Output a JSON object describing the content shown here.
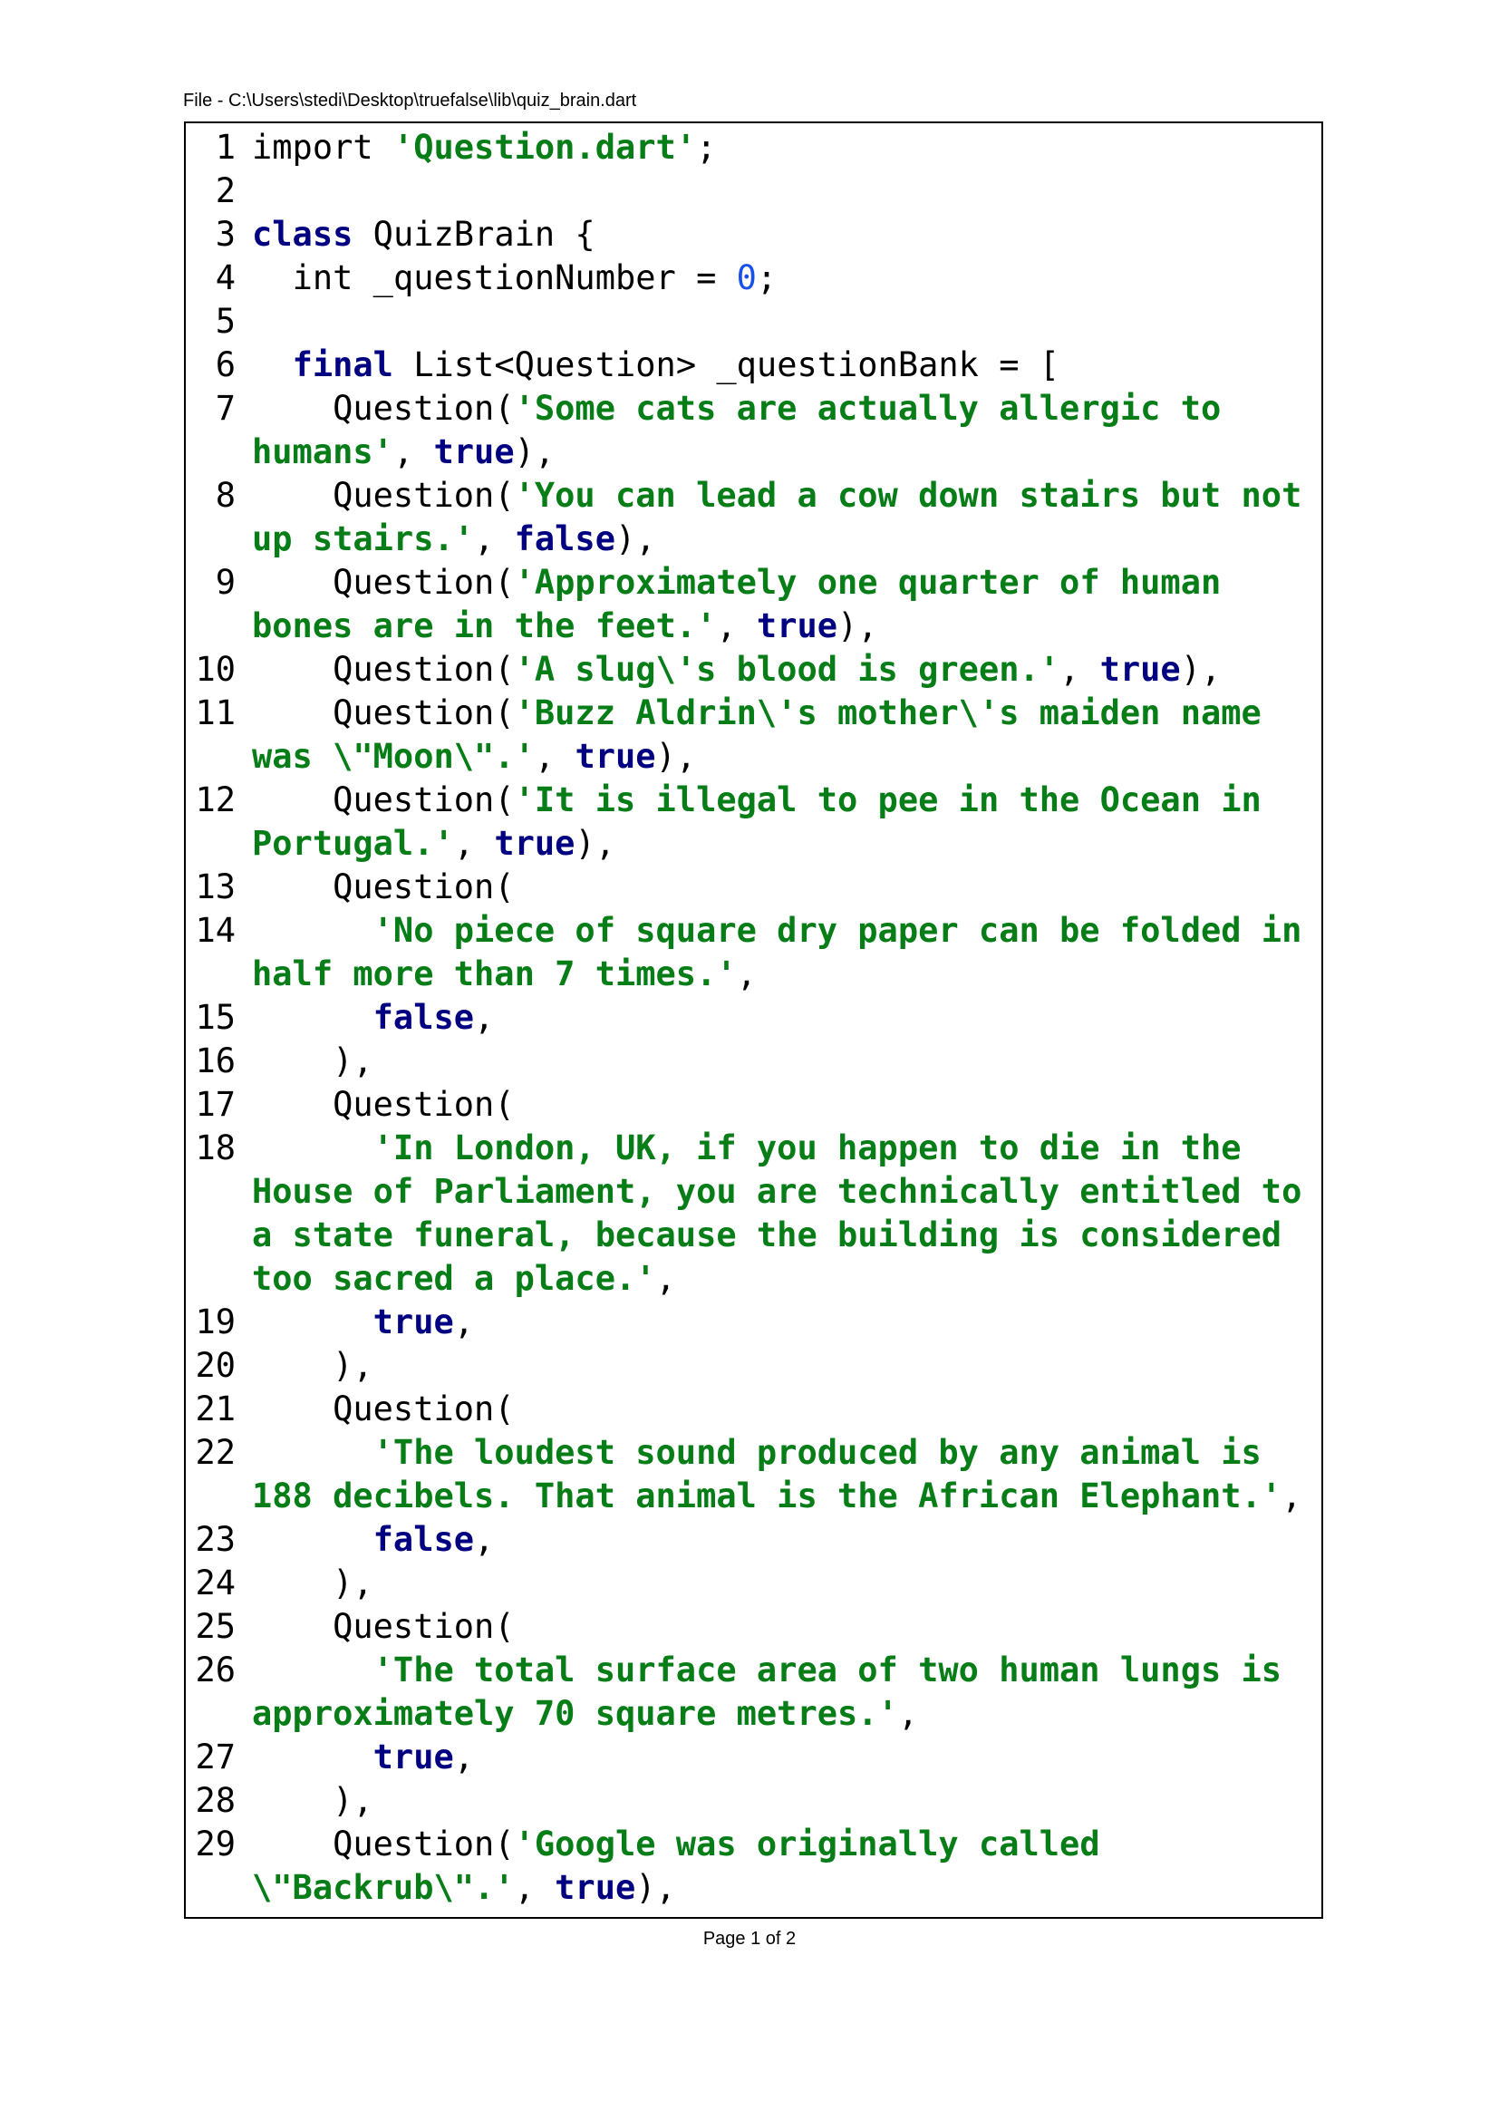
{
  "header": {
    "file_path": "File - C:\\Users\\stedi\\Desktop\\truefalse\\lib\\quiz_brain.dart"
  },
  "footer": {
    "page_label": "Page 1 of 2"
  },
  "colors": {
    "keyword": "#000080",
    "string": "#067d17",
    "number": "#1750eb",
    "plain": "#000000"
  },
  "code": {
    "lines": [
      {
        "no": "1",
        "tokens": [
          {
            "t": "plain",
            "v": "import "
          },
          {
            "t": "str",
            "v": "'Question.dart'"
          },
          {
            "t": "plain",
            "v": ";"
          }
        ]
      },
      {
        "no": "2",
        "tokens": []
      },
      {
        "no": "3",
        "tokens": [
          {
            "t": "kw",
            "v": "class"
          },
          {
            "t": "plain",
            "v": " QuizBrain {"
          }
        ]
      },
      {
        "no": "4",
        "tokens": [
          {
            "t": "plain",
            "v": "  int _questionNumber = "
          },
          {
            "t": "num",
            "v": "0"
          },
          {
            "t": "plain",
            "v": ";"
          }
        ]
      },
      {
        "no": "5",
        "tokens": []
      },
      {
        "no": "6",
        "tokens": [
          {
            "t": "plain",
            "v": "  "
          },
          {
            "t": "kw",
            "v": "final"
          },
          {
            "t": "plain",
            "v": " List<Question> _questionBank = ["
          }
        ]
      },
      {
        "no": "7",
        "tokens": [
          {
            "t": "plain",
            "v": "    Question("
          },
          {
            "t": "str",
            "v": "'Some cats are actually allergic to humans'"
          },
          {
            "t": "plain",
            "v": ", "
          },
          {
            "t": "kw",
            "v": "true"
          },
          {
            "t": "plain",
            "v": "),"
          }
        ]
      },
      {
        "no": "8",
        "tokens": [
          {
            "t": "plain",
            "v": "    Question("
          },
          {
            "t": "str",
            "v": "'You can lead a cow down stairs but not up stairs.'"
          },
          {
            "t": "plain",
            "v": ", "
          },
          {
            "t": "kw",
            "v": "false"
          },
          {
            "t": "plain",
            "v": "),"
          }
        ]
      },
      {
        "no": "9",
        "tokens": [
          {
            "t": "plain",
            "v": "    Question("
          },
          {
            "t": "str",
            "v": "'Approximately one quarter of human bones are in the feet.'"
          },
          {
            "t": "plain",
            "v": ", "
          },
          {
            "t": "kw",
            "v": "true"
          },
          {
            "t": "plain",
            "v": "),"
          }
        ]
      },
      {
        "no": "10",
        "tokens": [
          {
            "t": "plain",
            "v": "    Question("
          },
          {
            "t": "str",
            "v": "'A slug\\'s blood is green.'"
          },
          {
            "t": "plain",
            "v": ", "
          },
          {
            "t": "kw",
            "v": "true"
          },
          {
            "t": "plain",
            "v": "),"
          }
        ]
      },
      {
        "no": "11",
        "tokens": [
          {
            "t": "plain",
            "v": "    Question("
          },
          {
            "t": "str",
            "v": "'Buzz Aldrin\\'s mother\\'s maiden name was \\\"Moon\\\".'"
          },
          {
            "t": "plain",
            "v": ", "
          },
          {
            "t": "kw",
            "v": "true"
          },
          {
            "t": "plain",
            "v": "),"
          }
        ]
      },
      {
        "no": "12",
        "tokens": [
          {
            "t": "plain",
            "v": "    Question("
          },
          {
            "t": "str",
            "v": "'It is illegal to pee in the Ocean in Portugal.'"
          },
          {
            "t": "plain",
            "v": ", "
          },
          {
            "t": "kw",
            "v": "true"
          },
          {
            "t": "plain",
            "v": "),"
          }
        ]
      },
      {
        "no": "13",
        "tokens": [
          {
            "t": "plain",
            "v": "    Question("
          }
        ]
      },
      {
        "no": "14",
        "tokens": [
          {
            "t": "plain",
            "v": "      "
          },
          {
            "t": "str",
            "v": "'No piece of square dry paper can be folded in half more than 7 times.'"
          },
          {
            "t": "plain",
            "v": ","
          }
        ]
      },
      {
        "no": "15",
        "tokens": [
          {
            "t": "plain",
            "v": "      "
          },
          {
            "t": "kw",
            "v": "false"
          },
          {
            "t": "plain",
            "v": ","
          }
        ]
      },
      {
        "no": "16",
        "tokens": [
          {
            "t": "plain",
            "v": "    ),"
          }
        ]
      },
      {
        "no": "17",
        "tokens": [
          {
            "t": "plain",
            "v": "    Question("
          }
        ]
      },
      {
        "no": "18",
        "tokens": [
          {
            "t": "plain",
            "v": "      "
          },
          {
            "t": "str",
            "v": "'In London, UK, if you happen to die in the House of Parliament, you are technically entitled to a state funeral, because the building is considered too sacred a place.'"
          },
          {
            "t": "plain",
            "v": ","
          }
        ]
      },
      {
        "no": "19",
        "tokens": [
          {
            "t": "plain",
            "v": "      "
          },
          {
            "t": "kw",
            "v": "true"
          },
          {
            "t": "plain",
            "v": ","
          }
        ]
      },
      {
        "no": "20",
        "tokens": [
          {
            "t": "plain",
            "v": "    ),"
          }
        ]
      },
      {
        "no": "21",
        "tokens": [
          {
            "t": "plain",
            "v": "    Question("
          }
        ]
      },
      {
        "no": "22",
        "tokens": [
          {
            "t": "plain",
            "v": "      "
          },
          {
            "t": "str",
            "v": "'The loudest sound produced by any animal is 188 decibels. That animal is the African Elephant.'"
          },
          {
            "t": "plain",
            "v": ","
          }
        ]
      },
      {
        "no": "23",
        "tokens": [
          {
            "t": "plain",
            "v": "      "
          },
          {
            "t": "kw",
            "v": "false"
          },
          {
            "t": "plain",
            "v": ","
          }
        ]
      },
      {
        "no": "24",
        "tokens": [
          {
            "t": "plain",
            "v": "    ),"
          }
        ]
      },
      {
        "no": "25",
        "tokens": [
          {
            "t": "plain",
            "v": "    Question("
          }
        ]
      },
      {
        "no": "26",
        "tokens": [
          {
            "t": "plain",
            "v": "      "
          },
          {
            "t": "str",
            "v": "'The total surface area of two human lungs is approximately 70 square metres.'"
          },
          {
            "t": "plain",
            "v": ","
          }
        ]
      },
      {
        "no": "27",
        "tokens": [
          {
            "t": "plain",
            "v": "      "
          },
          {
            "t": "kw",
            "v": "true"
          },
          {
            "t": "plain",
            "v": ","
          }
        ]
      },
      {
        "no": "28",
        "tokens": [
          {
            "t": "plain",
            "v": "    ),"
          }
        ]
      },
      {
        "no": "29",
        "tokens": [
          {
            "t": "plain",
            "v": "    Question("
          },
          {
            "t": "str",
            "v": "'Google was originally called \\\"Backrub\\\".'"
          },
          {
            "t": "plain",
            "v": ", "
          },
          {
            "t": "kw",
            "v": "true"
          },
          {
            "t": "plain",
            "v": "),"
          }
        ]
      }
    ]
  }
}
